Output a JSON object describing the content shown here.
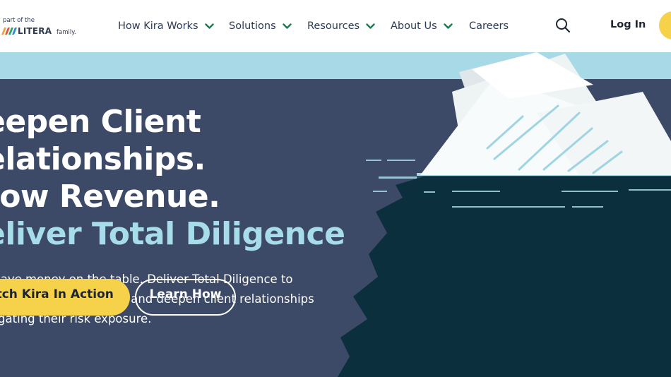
{
  "header": {
    "logo": {
      "tagline": "part of the",
      "brand": "LITERA",
      "suffix": "family.",
      "icon": "litera-logo-icon"
    },
    "nav": [
      {
        "label": "How Kira Works",
        "has_dropdown": true
      },
      {
        "label": "Solutions",
        "has_dropdown": true
      },
      {
        "label": "Resources",
        "has_dropdown": true
      },
      {
        "label": "About Us",
        "has_dropdown": true
      },
      {
        "label": "Careers",
        "has_dropdown": false
      }
    ],
    "search_icon": "search-icon",
    "login_label": "Log In"
  },
  "hero": {
    "headline": [
      "eepen Client",
      "elationships.",
      "row Revenue.",
      "eliver Total Diligence"
    ],
    "subtext": [
      "leave money on the table. Deliver Total Diligence to",
      "e new revenue streams and deepen client relationships",
      "tigating their risk exposure."
    ],
    "primary_button": "atch Kira In Action",
    "secondary_button": "Learn How"
  },
  "colors": {
    "hero_bg": "#3d4a67",
    "sky": "#a8d9e7",
    "accent_text": "#a7dce9",
    "button_yellow": "#f6d24a",
    "nav_chevron": "#1e7a4e",
    "deep_water": "#0c2f3d"
  }
}
